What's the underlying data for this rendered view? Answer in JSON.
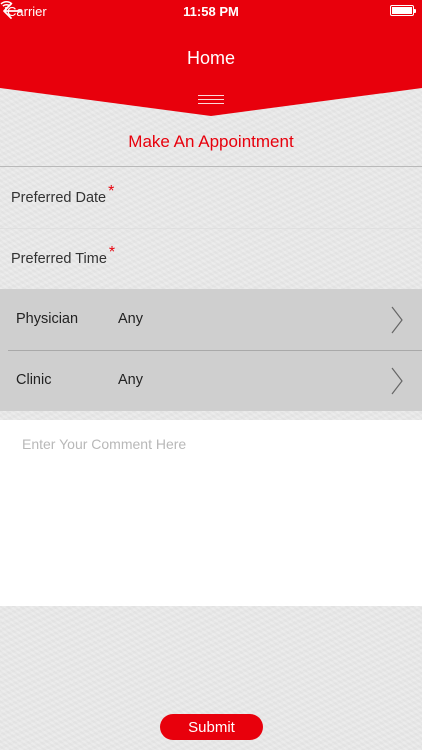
{
  "status_bar": {
    "carrier": "Carrier",
    "time": "11:58 PM"
  },
  "nav": {
    "title": "Home"
  },
  "form": {
    "title": "Make An Appointment",
    "preferred_date_label": "Preferred Date",
    "preferred_time_label": "Preferred Time",
    "required_mark": "*",
    "physician": {
      "label": "Physician",
      "value": "Any"
    },
    "clinic": {
      "label": "Clinic",
      "value": "Any"
    },
    "comment_placeholder": "Enter Your Comment Here",
    "submit_label": "Submit"
  },
  "colors": {
    "accent": "#e8000c",
    "background": "#e8e8e8",
    "select_bg": "#cfcfcf"
  },
  "icons": {
    "back": "arrow-left-icon",
    "menu": "hamburger-menu-icon",
    "chevron": "chevron-right-icon"
  }
}
